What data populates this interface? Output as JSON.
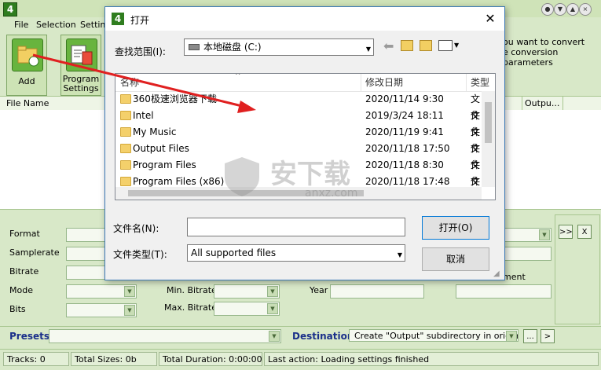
{
  "app": {
    "menu": [
      "File",
      "Selection",
      "Settings"
    ],
    "toolbar": [
      {
        "label": "Add",
        "icon": "add-folder-icon"
      },
      {
        "label": "Program\nSettings",
        "icon": "program-settings-icon"
      }
    ],
    "hint": [
      "ou want to convert",
      "e conversion parameters"
    ],
    "file_columns": [
      "File Name",
      "Outpu..."
    ],
    "fields": {
      "format": "Format",
      "samplerate": "Samplerate",
      "bitrate": "Bitrate",
      "mode": "Mode",
      "bits": "Bits",
      "min_bitrate": "Min. Bitrate",
      "max_bitrate": "Max. Bitrate",
      "year": "Year",
      "comment": "ment"
    },
    "side_buttons": [
      ">>",
      "X"
    ],
    "presets_label": "Presets",
    "destination_label": "Destination",
    "destination_value": "Create \"Output\" subdirectory in original",
    "dest_buttons": [
      "...",
      ">"
    ],
    "status": {
      "tracks": "Tracks: 0",
      "sizes": "Total Sizes: 0b",
      "duration": "Total Duration: 0:00:00",
      "last": "Last action: Loading settings finished"
    }
  },
  "dialog": {
    "title": "打开",
    "lookin_label": "查找范围(I):",
    "lookin_value": "本地磁盘 (C:)",
    "columns": {
      "name": "名称",
      "date": "修改日期",
      "type": "类型"
    },
    "rows": [
      {
        "name": "360极速浏览器下载",
        "date": "2020/11/14 9:30",
        "type": "文件"
      },
      {
        "name": "Intel",
        "date": "2019/3/24 18:11",
        "type": "文件"
      },
      {
        "name": "My Music",
        "date": "2020/11/19 9:41",
        "type": "文件"
      },
      {
        "name": "Output Files",
        "date": "2020/11/18 17:50",
        "type": "文件"
      },
      {
        "name": "Program Files",
        "date": "2020/11/18 8:30",
        "type": "文件"
      },
      {
        "name": "Program Files (x86)",
        "date": "2020/11/18 17:48",
        "type": "文件"
      }
    ],
    "filename_label": "文件名(N):",
    "filename_value": "",
    "filetype_label": "文件类型(T):",
    "filetype_value": "All supported files",
    "open_button": "打开(O)",
    "cancel_button": "取消"
  },
  "watermark": {
    "text": "安下载",
    "sub": "anxz.com"
  },
  "colors": {
    "accent_red": "#e02020",
    "app_green": "#2f7d1f",
    "dialog_border": "#3d7ab5"
  }
}
